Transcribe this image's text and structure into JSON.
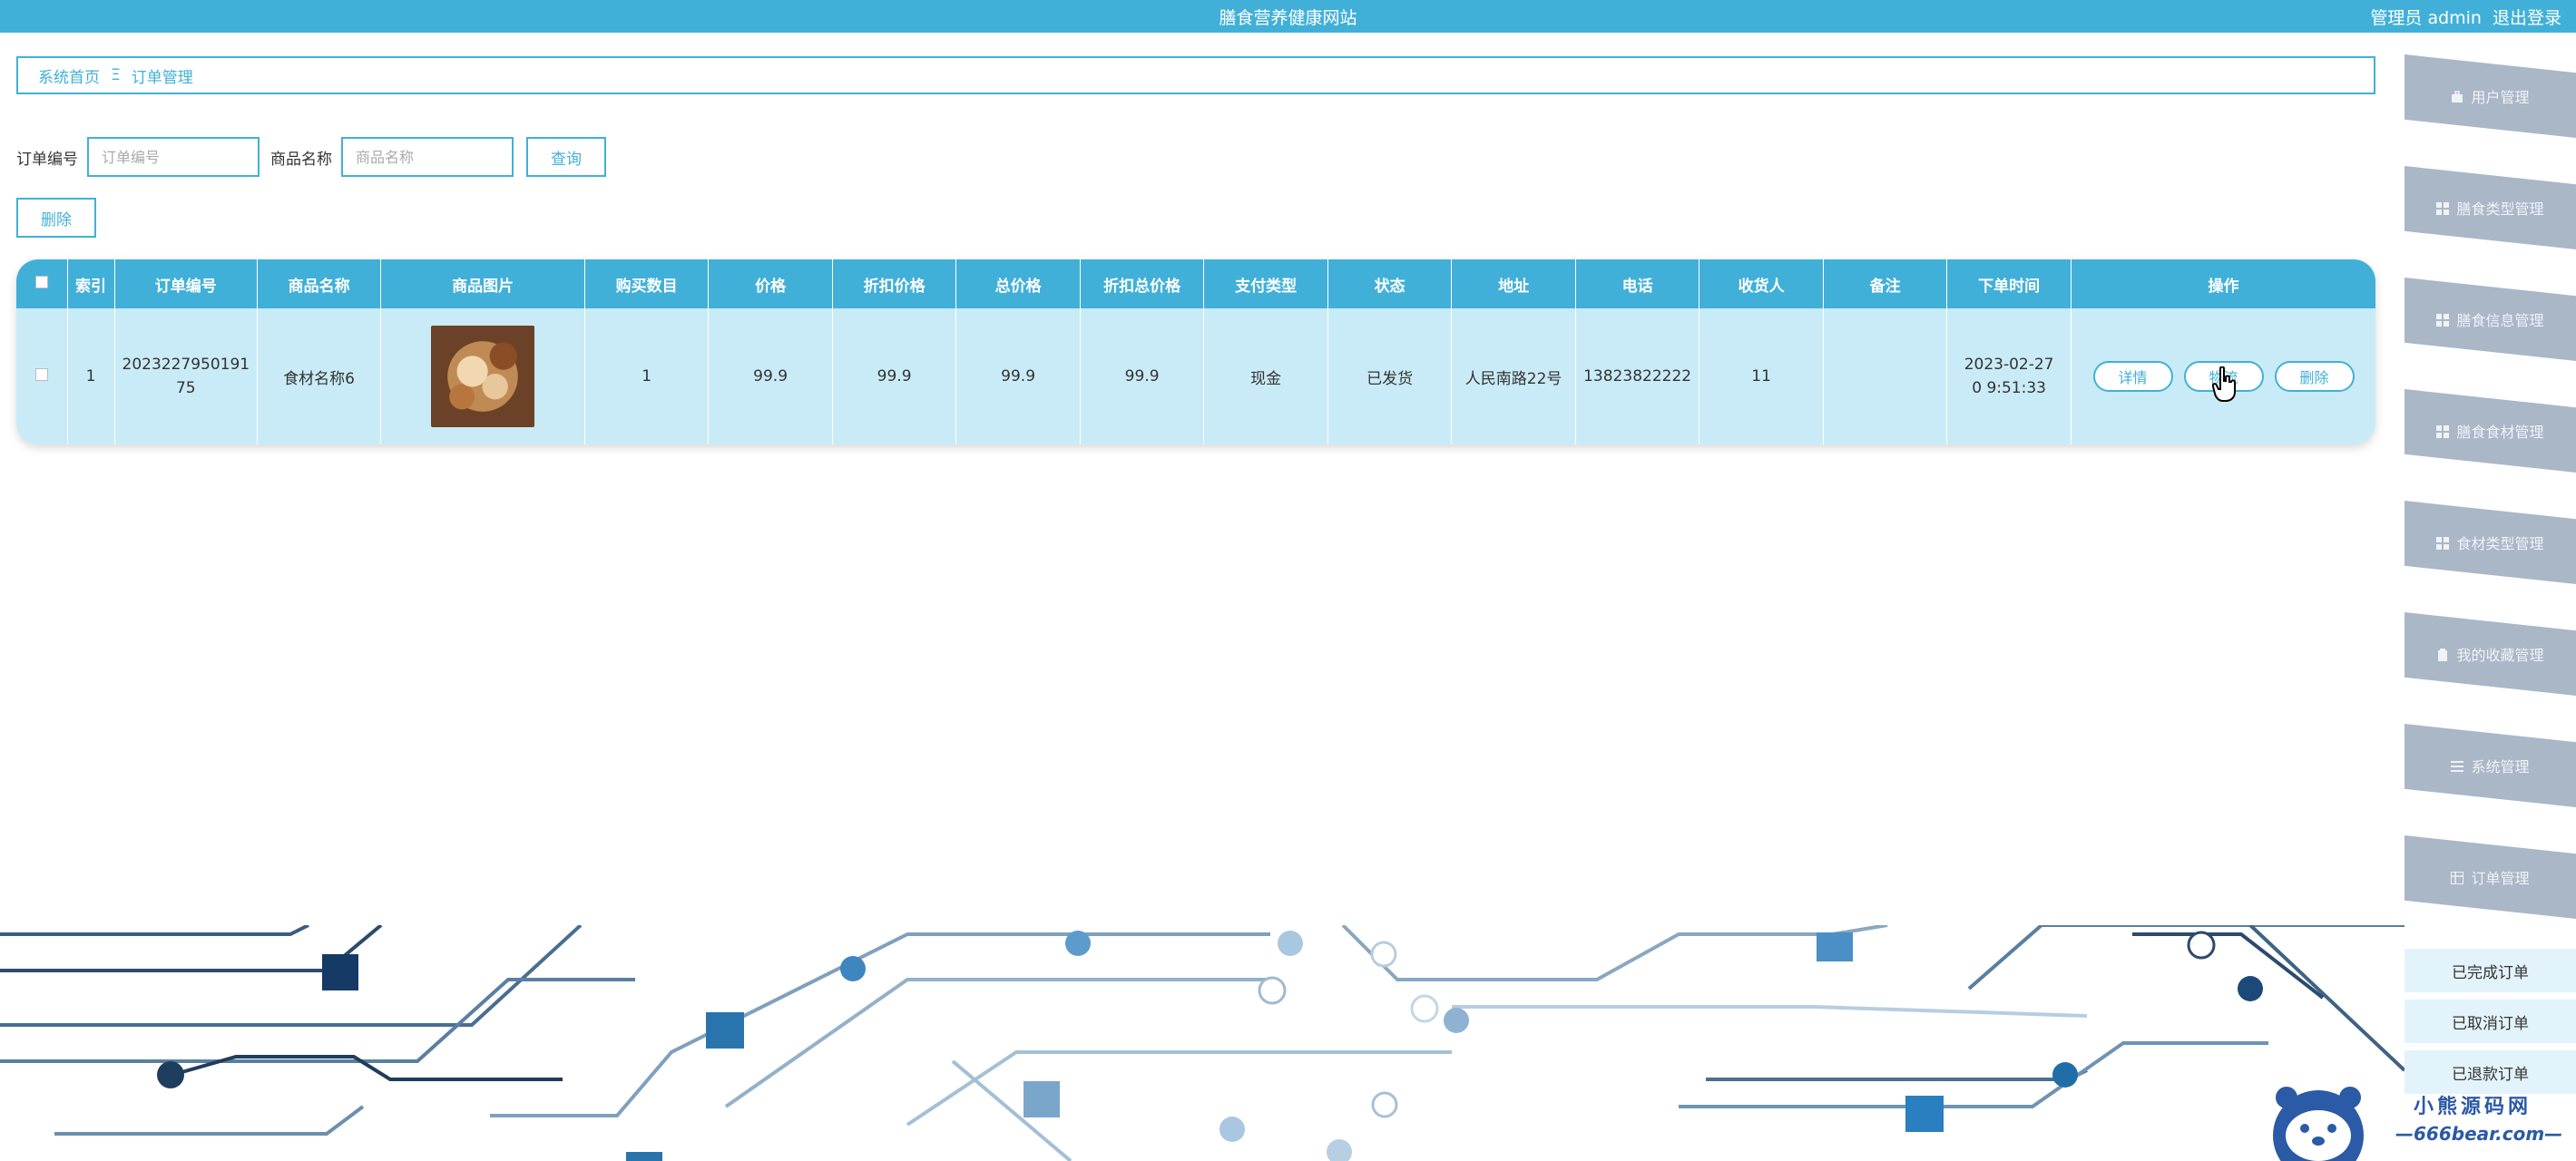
{
  "header": {
    "site_title": "膳食营养健康网站",
    "user_label": "管理员 admin",
    "logout_label": "退出登录"
  },
  "breadcrumb": {
    "home": "系统首页",
    "separator": "Ξ",
    "current": "订单管理"
  },
  "search": {
    "order_no_label": "订单编号",
    "order_no_placeholder": "订单编号",
    "product_name_label": "商品名称",
    "product_name_placeholder": "商品名称",
    "query_label": "查询"
  },
  "actions": {
    "delete_label": "删除"
  },
  "table": {
    "columns": [
      "",
      "索引",
      "订单编号",
      "商品名称",
      "商品图片",
      "购买数目",
      "价格",
      "折扣价格",
      "总价格",
      "折扣总价格",
      "支付类型",
      "状态",
      "地址",
      "电话",
      "收货人",
      "备注",
      "下单时间",
      "操作"
    ],
    "rows": [
      {
        "index": "1",
        "order_no": "2023227950191 75",
        "product_name": "食材名称6",
        "quantity": "1",
        "price": "99.9",
        "discount_price": "99.9",
        "total_price": "99.9",
        "discount_total_price": "99.9",
        "pay_type": "现金",
        "status": "已发货",
        "address": "人民南路22号",
        "phone": "13823822222",
        "receiver": "11",
        "remark": "",
        "order_time": "2023-02-27 0 9:51:33",
        "op_detail": "详情",
        "op_logistics": "物流",
        "op_delete": "删除"
      }
    ]
  },
  "sidebar": {
    "items": [
      {
        "label": "用户管理",
        "icon": "briefcase-icon"
      },
      {
        "label": "膳食类型管理",
        "icon": "grid-icon"
      },
      {
        "label": "膳食信息管理",
        "icon": "grid-icon"
      },
      {
        "label": "膳食食材管理",
        "icon": "grid-icon"
      },
      {
        "label": "食材类型管理",
        "icon": "grid-icon"
      },
      {
        "label": "我的收藏管理",
        "icon": "clipboard-icon"
      },
      {
        "label": "系统管理",
        "icon": "menu-icon"
      },
      {
        "label": "订单管理",
        "icon": "table-icon"
      }
    ],
    "sub_items": [
      "已完成订单",
      "已取消订单",
      "已退款订单"
    ]
  },
  "watermark": {
    "title": "小熊源码网",
    "url": "—666bear.com—"
  },
  "colors": {
    "accent": "#41b0d8",
    "row_bg": "#c9ebf7",
    "sidebar_item": "#a9b7c7"
  }
}
